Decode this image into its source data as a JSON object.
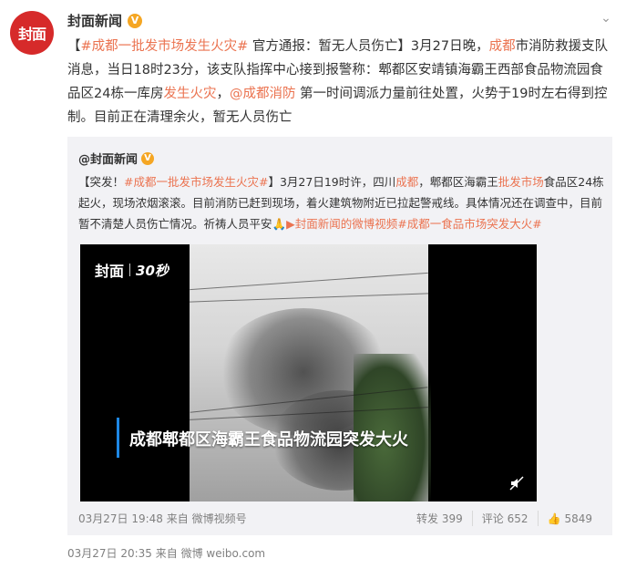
{
  "avatar": {
    "label": "封面"
  },
  "post": {
    "author": "封面新闻",
    "verified": "V",
    "main": {
      "p1": "【",
      "topic1": "#成都一批发市场发生火灾#",
      "p2": " 官方通报：暂无人员伤亡】3月27日晚，",
      "chengdu": "成都",
      "p3": "市消防救援支队消息，当日18时23分，该支队指挥中心接到报警称：郫都区安靖镇海霸王西部食品物流园食品区24栋一库房",
      "fire": "发生火灾",
      "p4": "，",
      "mention": "@成都消防",
      "p5": " 第一时间调派力量前往处置，火势于19时左右得到控制。目前正在清理余火，暂无人员伤亡"
    },
    "footer": "03月27日 20:35  来自 微博 weibo.com"
  },
  "retweet": {
    "author": "@封面新闻",
    "verified": "V",
    "text": {
      "p1": "【突发！",
      "topic1": "#成都一批发市场发生火灾#",
      "p2": "】3月27日19时许，四川",
      "chengdu": "成都",
      "p3": "，郫都区海霸王",
      "market": "批发市场",
      "p4": "食品区24栋起火，现场浓烟滚滚。目前消防已赶到现场，着火建筑物附近已拉起警戒线。具体情况还在调查中，目前暂不清楚人员伤亡情况。祈祷人员平安",
      "pray": "🙏",
      "video_link": "封面新闻的微博视频",
      "topic2": "#成都一食品市场突发大火#"
    },
    "video": {
      "brand": "封面",
      "brand_sub": "30秒",
      "caption": "成都郫都区海霸王食品物流园突发大火"
    },
    "meta": "03月27日 19:48  来自 微博视频号",
    "reposts": "转发 399",
    "comments": "评论 652",
    "likes": "5849"
  },
  "colors": {
    "link": "#eb7350",
    "badge": "#f5a623",
    "avatar": "#d62a2a",
    "retweet_bg": "#f2f2f5"
  },
  "icons": [
    "chevron-down-icon",
    "verified-icon",
    "mute-icon",
    "thumb-up-icon",
    "video-link-icon"
  ]
}
